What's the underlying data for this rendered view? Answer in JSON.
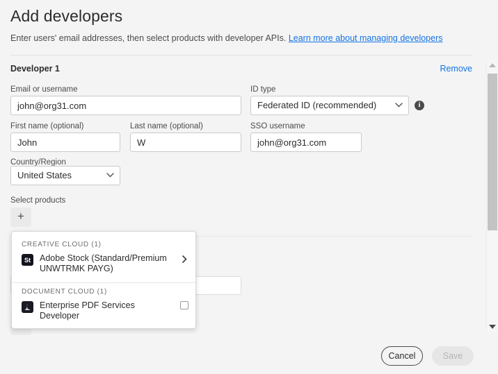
{
  "header": {
    "title": "Add developers",
    "subtitle_text": "Enter users' email addresses, then select products with developer APIs.",
    "learn_more_link": "Learn more about managing developers"
  },
  "developer_section": {
    "label": "Developer 1",
    "remove_label": "Remove",
    "fields": {
      "email": {
        "label": "Email or username",
        "value": "john@org31.com"
      },
      "id_type": {
        "label": "ID type",
        "value": "Federated ID (recommended)",
        "chevron": "chevron-down-icon",
        "info": "i"
      },
      "first_name": {
        "label": "First name (optional)",
        "value": "John"
      },
      "last_name": {
        "label": "Last name (optional)",
        "value": "W"
      },
      "sso_username": {
        "label": "SSO username",
        "value": "john@org31.com"
      },
      "country": {
        "label": "Country/Region",
        "value": "United States",
        "chevron": "chevron-down-icon"
      }
    },
    "select_products": {
      "label": "Select products",
      "add_button": "+"
    }
  },
  "product_popup": {
    "groups": [
      {
        "title": "CREATIVE CLOUD (1)",
        "items": [
          {
            "icon_label": "St",
            "icon_name": "adobe-stock-icon",
            "name": "Adobe Stock (Standard/Premium UNWTRMK PAYG)",
            "affordance": "chevron-right-icon",
            "chevron": "❯"
          }
        ]
      },
      {
        "title": "DOCUMENT CLOUD (1)",
        "items": [
          {
            "icon_label": "A",
            "icon_name": "acrobat-pdf-icon",
            "name": "Enterprise PDF Services Developer",
            "affordance": "checkbox",
            "checked": false
          }
        ]
      }
    ]
  },
  "footer": {
    "cancel_label": "Cancel",
    "save_label": "Save",
    "save_disabled": true
  },
  "scrollbar": {
    "up_arrow": "triangle-up-icon",
    "down_arrow": "triangle-down-icon"
  },
  "colors": {
    "link_blue": "#1473e6",
    "page_bg": "#f4f4f4",
    "text": "#2c2c2c",
    "border": "#cacaca"
  }
}
